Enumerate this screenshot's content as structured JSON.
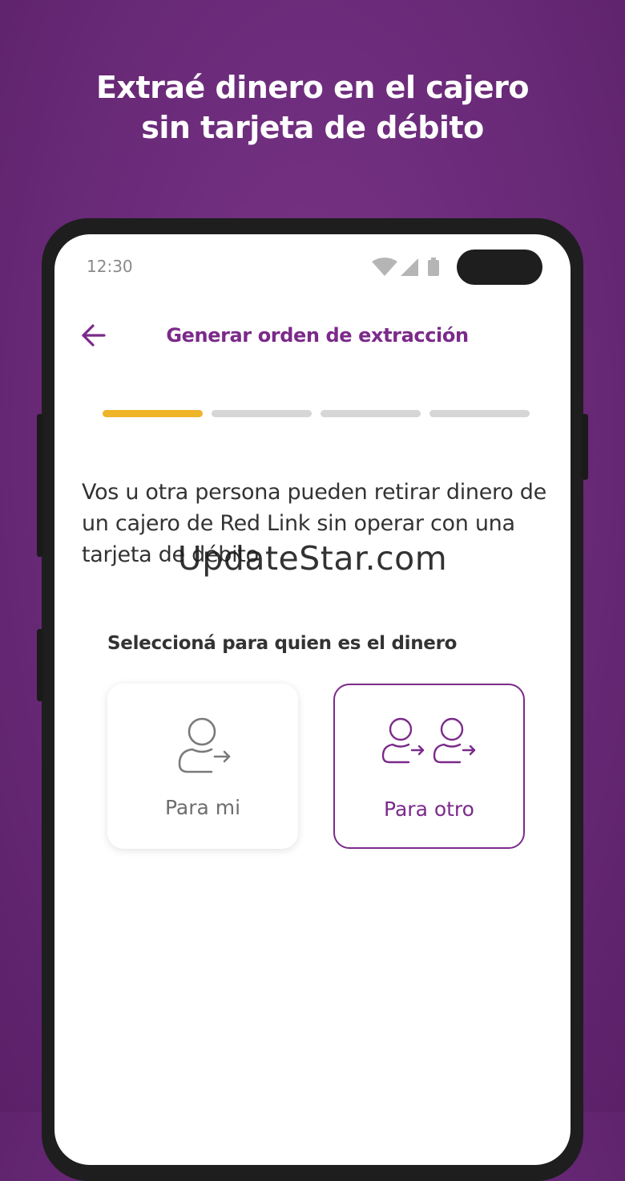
{
  "promo": {
    "headline_line1": "Extraé dinero en el cajero",
    "headline_line2": "sin tarjeta de débito"
  },
  "status_bar": {
    "time": "12:30",
    "icons": [
      "wifi-icon",
      "signal-icon",
      "battery-icon"
    ]
  },
  "app_bar": {
    "back_icon": "arrow-left-icon",
    "title": "Generar orden de extracción"
  },
  "progress": {
    "total_steps": 4,
    "current_step": 1,
    "active_color": "#f0b429",
    "inactive_color": "#d6d6d6"
  },
  "content": {
    "intro_text": "Vos u otra persona pueden retirar dinero de un cajero de Red Link sin operar con una tarjeta de débito",
    "select_label": "Seleccioná para quien es el dinero",
    "options": [
      {
        "label": "Para mi",
        "icon": "person-arrow-icon",
        "selected": false
      },
      {
        "label": "Para otro",
        "icon": "two-persons-arrow-icon",
        "selected": true
      }
    ]
  },
  "watermark": "UpdateStar.com",
  "colors": {
    "brand_purple": "#7b2a8a",
    "background_purple": "#6a2a78"
  }
}
